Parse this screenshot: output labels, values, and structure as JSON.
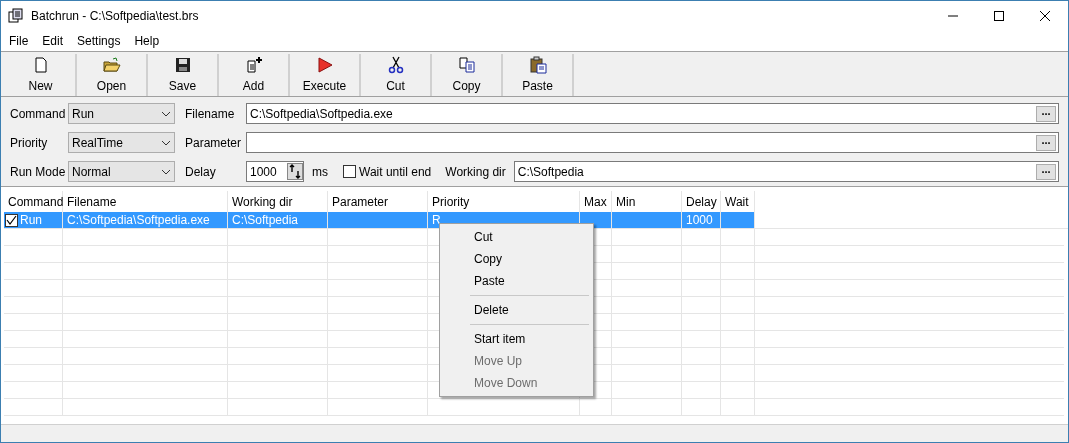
{
  "window": {
    "title": "Batchrun - C:\\Softpedia\\test.brs"
  },
  "menu_bar": [
    {
      "label": "File"
    },
    {
      "label": "Edit"
    },
    {
      "label": "Settings"
    },
    {
      "label": "Help"
    }
  ],
  "toolbar": [
    {
      "label": "New",
      "kind": "new"
    },
    {
      "label": "Open",
      "kind": "open"
    },
    {
      "label": "Save",
      "kind": "save"
    },
    {
      "label": "Add",
      "kind": "add"
    },
    {
      "label": "Execute",
      "kind": "execute"
    },
    {
      "label": "Cut",
      "kind": "cut"
    },
    {
      "label": "Copy",
      "kind": "copy"
    },
    {
      "label": "Paste",
      "kind": "paste"
    }
  ],
  "form": {
    "command": {
      "label": "Command",
      "value": "Run"
    },
    "priority": {
      "label": "Priority",
      "value": "RealTime"
    },
    "run_mode": {
      "label": "Run Mode",
      "value": "Normal"
    },
    "filename": {
      "label": "Filename",
      "value": "C:\\Softpedia\\Softpedia.exe",
      "browse": "..."
    },
    "parameter": {
      "label": "Parameter",
      "browse": "..."
    },
    "delay": {
      "label": "Delay",
      "value": "1000",
      "unit": "ms"
    },
    "wait_until_end": {
      "label": "Wait until end",
      "checked": false
    },
    "working_dir": {
      "label": "Working dir",
      "value": "C:\\Softpedia",
      "browse": "..."
    }
  },
  "table": {
    "columns": [
      "Command",
      "Filename",
      "Working dir",
      "Parameter",
      "Priority",
      "Max",
      "Min",
      "Delay",
      "Wait"
    ],
    "rows": [
      {
        "checked": true,
        "selected": true,
        "cells": [
          "Run",
          "C:\\Softpedia\\Softpedia.exe",
          "C:\\Softpedia",
          "",
          "R",
          "",
          "",
          "1000",
          ""
        ]
      }
    ]
  },
  "context_menu": [
    {
      "label": "Cut",
      "disabled": false
    },
    {
      "label": "Copy",
      "disabled": false
    },
    {
      "label": "Paste",
      "disabled": false
    },
    {
      "kind": "separator"
    },
    {
      "label": "Delete",
      "disabled": false
    },
    {
      "kind": "separator"
    },
    {
      "label": "Start item",
      "disabled": false
    },
    {
      "label": "Move Up",
      "disabled": true
    },
    {
      "label": "Move Down",
      "disabled": true
    }
  ]
}
